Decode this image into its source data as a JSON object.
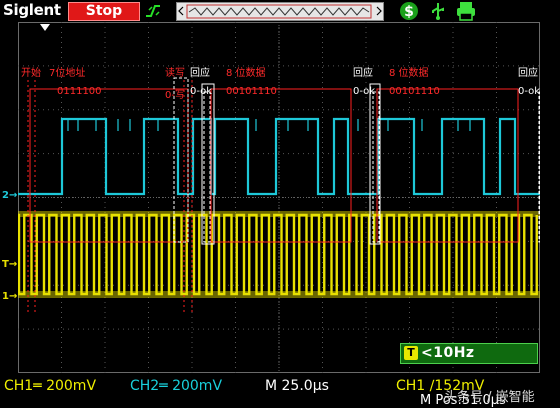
{
  "header": {
    "brand": "Siglent",
    "run_state": "Stop"
  },
  "icons": {
    "trigger_mode": "trigger-slope-icon",
    "dollar": "dollar-icon",
    "usb": "usb-icon",
    "print": "print-icon"
  },
  "annotations": {
    "start": "开始",
    "addr7": "7位地址",
    "addr_bits": "0111100",
    "rw": "读写",
    "rw_val": "0-写",
    "ack1": "回应",
    "ack1_val": "0-ok",
    "data1": "8 位数据",
    "data1_bits": "00101110",
    "ack2": "回应",
    "ack2_val": "0-ok",
    "data2": "8 位数据",
    "data2_bits": "00101110",
    "ack3": "回应",
    "ack3_val": "0-ok"
  },
  "markers": {
    "ch2": "2",
    "trig": "T",
    "ch1": "1"
  },
  "measure": {
    "frequency": "<10Hz"
  },
  "status": {
    "ch1": "CH1═ 200mV",
    "ch2": "CH2═ 200mV",
    "timebase": "M 25.0μs",
    "trigger": "CH1 ∕152mV",
    "mpos": "M Pos:51.0μs",
    "watermark": "头条号 / 嵌智能"
  },
  "colors": {
    "ch1": "#e8e000",
    "ch2": "#1ec8d8",
    "annotation": "#ff2020",
    "grid": "#3a3a3a"
  }
}
